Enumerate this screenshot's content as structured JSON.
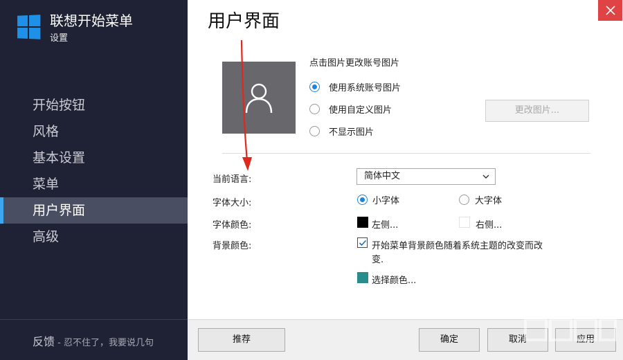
{
  "sidebar": {
    "brand_title": "联想开始菜单",
    "brand_subtitle": "设置",
    "items": [
      {
        "label": "开始按钮",
        "active": false
      },
      {
        "label": "风格",
        "active": false
      },
      {
        "label": "基本设置",
        "active": false
      },
      {
        "label": "菜单",
        "active": false
      },
      {
        "label": "用户界面",
        "active": true
      },
      {
        "label": "高级",
        "active": false
      }
    ],
    "feedback_label": "反馈",
    "feedback_sub": " - 忍不住了，我要说几句"
  },
  "main": {
    "title": "用户界面",
    "account_picture": {
      "hint": "点击图片更改账号图片",
      "options": [
        {
          "label": "使用系统账号图片",
          "checked": true
        },
        {
          "label": "使用自定义图片",
          "checked": false
        },
        {
          "label": "不显示图片",
          "checked": false
        }
      ],
      "change_button": "更改图片..."
    },
    "language": {
      "label": "当前语言:",
      "value": "简体中文"
    },
    "font_size": {
      "label": "字体大小:",
      "options": [
        {
          "label": "小字体",
          "checked": true
        },
        {
          "label": "大字体",
          "checked": false
        }
      ]
    },
    "font_color": {
      "label": "字体颜色:",
      "left_label": "左侧...",
      "left_color": "#000000",
      "right_label": "右侧...",
      "right_color": "#ffffff"
    },
    "background_color": {
      "label": "背景颜色:",
      "follow_theme_line1": "开始菜单背景颜色随着系统主题的改变而改",
      "follow_theme_line2": "变.",
      "follow_theme_checked": true,
      "choose_label": "选择颜色...",
      "choose_color": "#2a8c8c"
    }
  },
  "footer": {
    "recommend": "推荐",
    "ok": "确定",
    "cancel": "取消",
    "apply": "应用"
  },
  "colors": {
    "sidebar_bg": "#1f2235",
    "accent": "#3ea6ee",
    "close_red": "#e04343"
  }
}
